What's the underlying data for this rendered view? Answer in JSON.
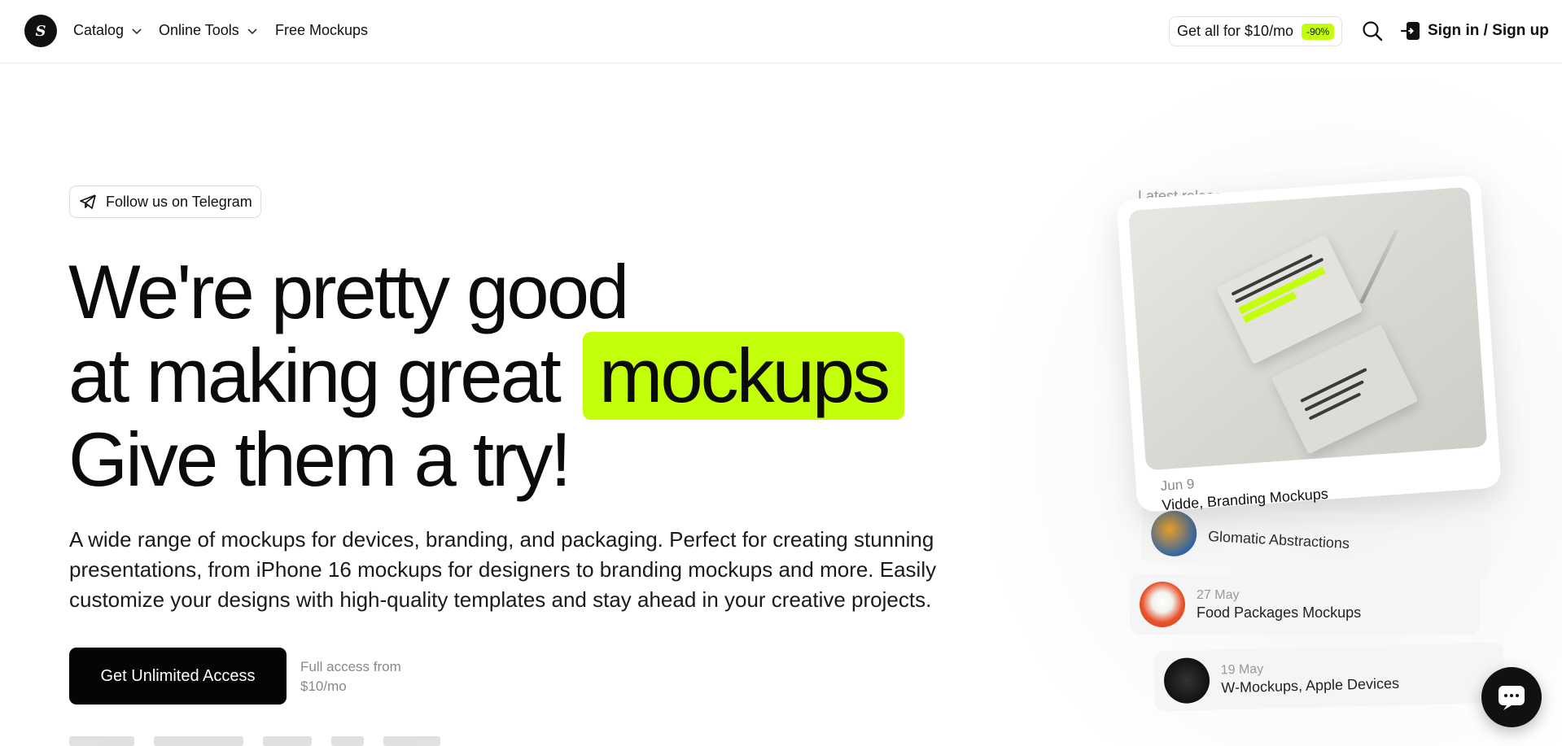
{
  "nav": {
    "logo_text": "S",
    "catalog": "Catalog",
    "online_tools": "Online Tools",
    "free_mockups": "Free Mockups",
    "promo_text": "Get all for $10/mo",
    "promo_badge": "-90%",
    "signin": "Sign in / Sign up",
    "icons": {
      "search": "search-icon",
      "signin": "sign-in-icon",
      "chevron": "chevron-down-icon"
    }
  },
  "hero": {
    "telegram_label": "Follow us on Telegram",
    "headline_line1": "We're pretty good",
    "headline_line2": "at making great",
    "headline_highlight": "mockups",
    "headline_line3": "Give them a try!",
    "description": "A wide range of mockups for devices, branding, and packaging. Perfect for creating stunning presentations, from iPhone 16 mockups for designers to branding mockups and more. Easily customize your designs with high-quality templates and stay ahead in your creative projects.",
    "cta_label": "Get Unlimited Access",
    "cta_note": "Full access from $10/mo"
  },
  "releases": {
    "label": "Latest releases",
    "featured": {
      "date": "Jun 9",
      "title": "Vidde, Branding Mockups"
    },
    "items": [
      {
        "date": "",
        "title": "Glomatic Abstractions"
      },
      {
        "date": "27 May",
        "title": "Food Packages Mockups"
      },
      {
        "date": "19 May",
        "title": "W-Mockups, Apple Devices"
      }
    ]
  },
  "colors": {
    "accent": "#c3ff0a",
    "primary_text": "#0b0b0b",
    "button_bg": "#050505",
    "muted_text": "#888888"
  }
}
